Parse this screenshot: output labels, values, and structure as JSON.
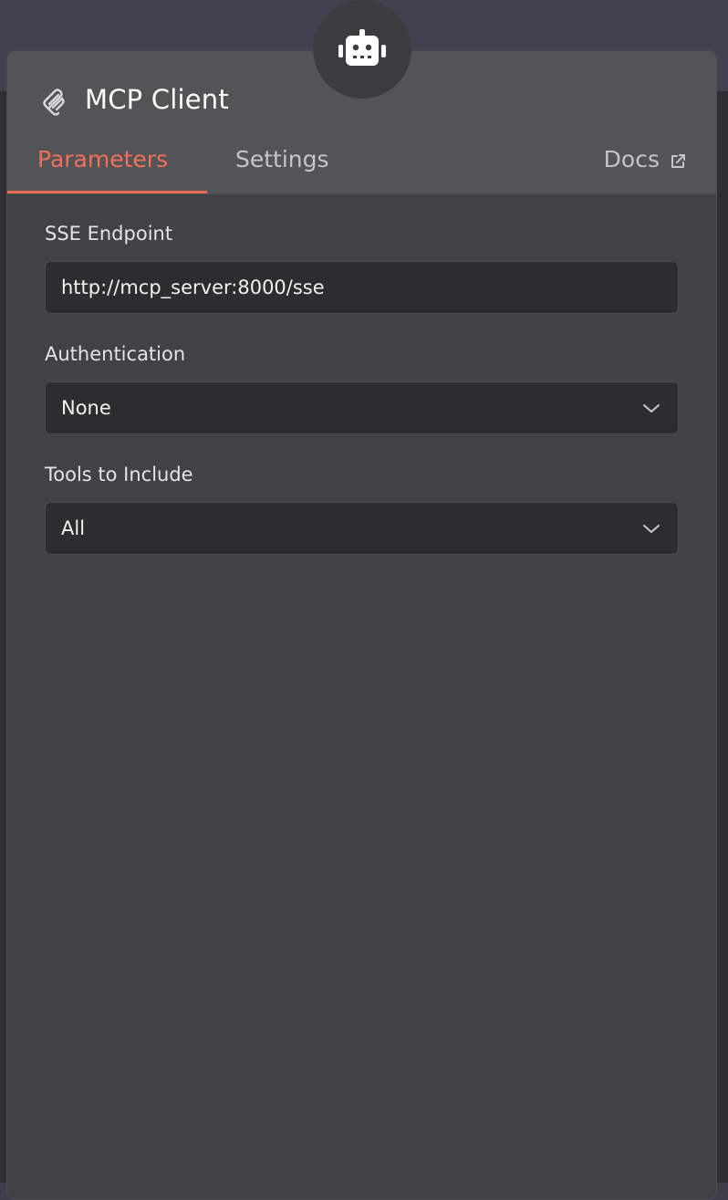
{
  "node": {
    "title": "MCP Client",
    "header_icon": "tools-icon",
    "badge_icon": "robot-icon"
  },
  "tabs": [
    {
      "label": "Parameters",
      "active": true
    },
    {
      "label": "Settings",
      "active": false
    }
  ],
  "docs": {
    "label": "Docs",
    "icon": "external-link-icon"
  },
  "fields": {
    "sse_endpoint": {
      "label": "SSE Endpoint",
      "value": "http://mcp_server:8000/sse"
    },
    "authentication": {
      "label": "Authentication",
      "value": "None"
    },
    "tools": {
      "label": "Tools to Include",
      "value": "All"
    }
  },
  "colors": {
    "accent": "#ee6c57",
    "panel": "#414244",
    "header": "#535456",
    "input_bg": "#2c2d2e"
  }
}
